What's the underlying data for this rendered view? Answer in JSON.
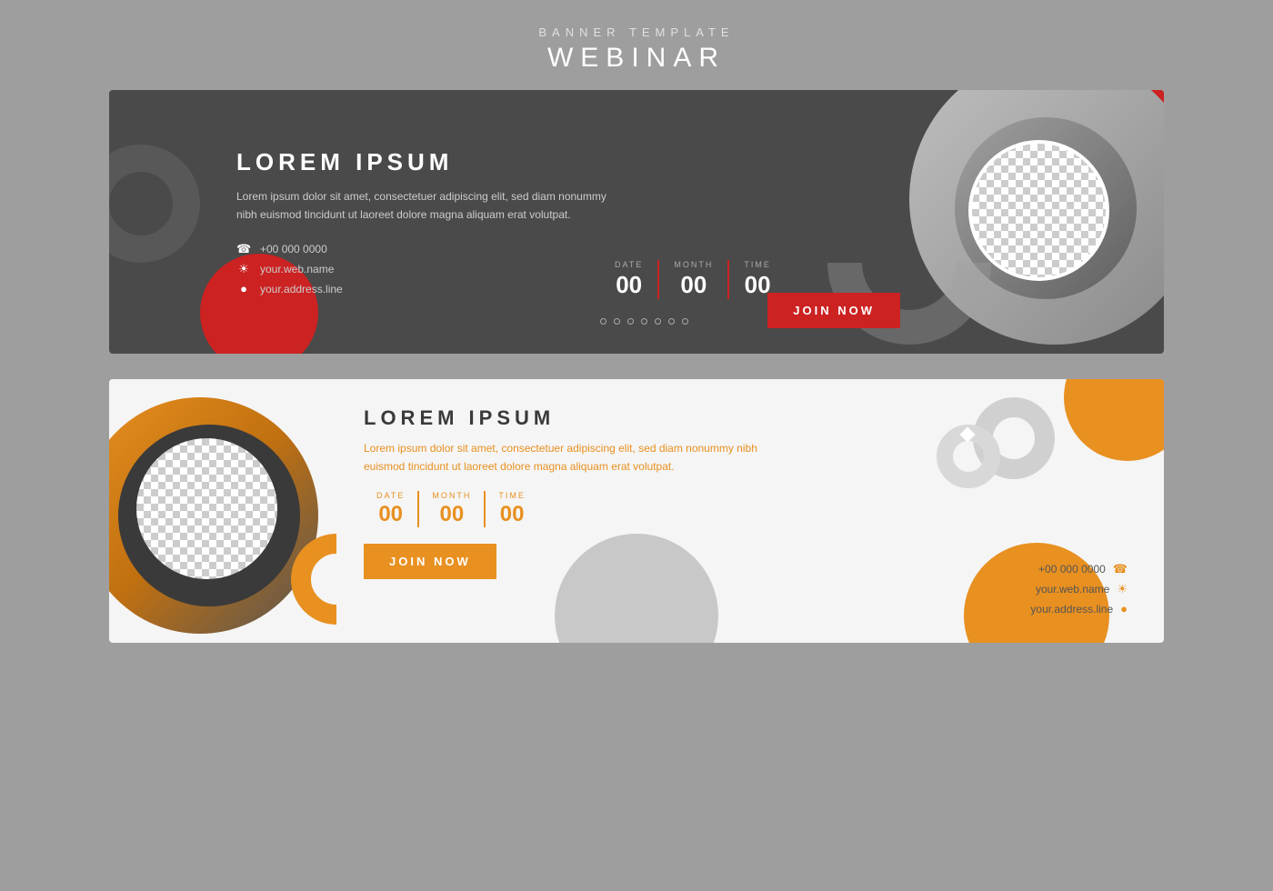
{
  "page": {
    "subtitle": "BANNER TEMPLATE",
    "title": "WEBINAR",
    "bg_color": "#9e9e9e"
  },
  "banner1": {
    "heading": "LOREM IPSUM",
    "description": "Lorem ipsum dolor sit amet, consectetuer adipiscing elit, sed diam nonummy nibh euismod tincidunt ut laoreet dolore magna aliquam erat volutpat.",
    "date_label": "DATE",
    "date_value": "00",
    "month_label": "MONTH",
    "month_value": "00",
    "time_label": "TIME",
    "time_value": "00",
    "phone": "+00 000 0000",
    "website": "your.web.name",
    "address": "your.address.line",
    "join_label": "JOIN NOW",
    "accent_color": "#cc2222"
  },
  "banner2": {
    "heading": "LOREM IPSUM",
    "description": "Lorem ipsum dolor sit amet, consectetuer adipiscing elit, sed diam nonummy nibh euismod tincidunt ut laoreet dolore magna aliquam erat volutpat.",
    "date_label": "DATE",
    "date_value": "00",
    "month_label": "MONTH",
    "month_value": "00",
    "time_label": "TIME",
    "time_value": "00",
    "phone": "+00 000 0000",
    "website": "your.web.name",
    "address": "your.address.line",
    "join_label": "JOIN NOW",
    "accent_color": "#e89020"
  }
}
